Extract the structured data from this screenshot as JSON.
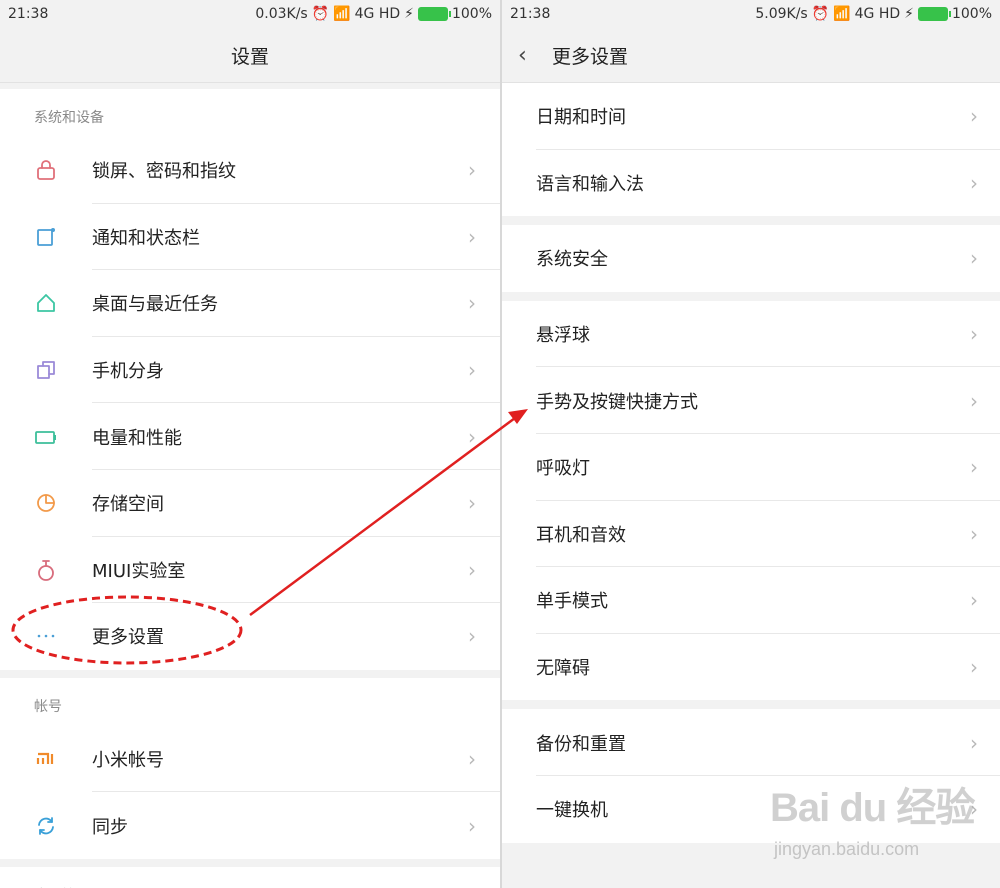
{
  "left": {
    "status": {
      "time": "21:38",
      "speed": "0.03K/s",
      "network": "4G HD",
      "battery": "100%"
    },
    "title": "设置",
    "sections": [
      {
        "label": "系统和设备",
        "items": [
          {
            "label": "锁屏、密码和指纹",
            "icon": "lock-icon",
            "color": "#e0707a"
          },
          {
            "label": "通知和状态栏",
            "icon": "notification-icon",
            "color": "#4a9fd6"
          },
          {
            "label": "桌面与最近任务",
            "icon": "home-icon",
            "color": "#3cc6a3"
          },
          {
            "label": "手机分身",
            "icon": "clone-icon",
            "color": "#9b8ad8"
          },
          {
            "label": "电量和性能",
            "icon": "battery-icon",
            "color": "#3cbf9a"
          },
          {
            "label": "存储空间",
            "icon": "pie-icon",
            "color": "#f29a4a"
          },
          {
            "label": "MIUI实验室",
            "icon": "flask-icon",
            "color": "#d86c7c"
          },
          {
            "label": "更多设置",
            "icon": "more-icon",
            "color": "#4a9fd6"
          }
        ]
      },
      {
        "label": "帐号",
        "items": [
          {
            "label": "小米帐号",
            "icon": "mi-logo-icon",
            "color": "#f08a2a"
          },
          {
            "label": "同步",
            "icon": "sync-icon",
            "color": "#3aa0d8"
          }
        ]
      },
      {
        "label": "应用管理",
        "items": []
      }
    ]
  },
  "right": {
    "status": {
      "time": "21:38",
      "speed": "5.09K/s",
      "network": "4G HD",
      "battery": "100%"
    },
    "title": "更多设置",
    "groups": [
      [
        "日期和时间",
        "语言和输入法"
      ],
      [
        "系统安全"
      ],
      [
        "悬浮球",
        "手势及按键快捷方式",
        "呼吸灯",
        "耳机和音效",
        "单手模式",
        "无障碍"
      ],
      [
        "备份和重置",
        "一键换机"
      ]
    ]
  },
  "annotation": {
    "color": "#e02020"
  },
  "watermark": {
    "logo": "Bai du 经验",
    "url": "jingyan.baidu.com"
  }
}
